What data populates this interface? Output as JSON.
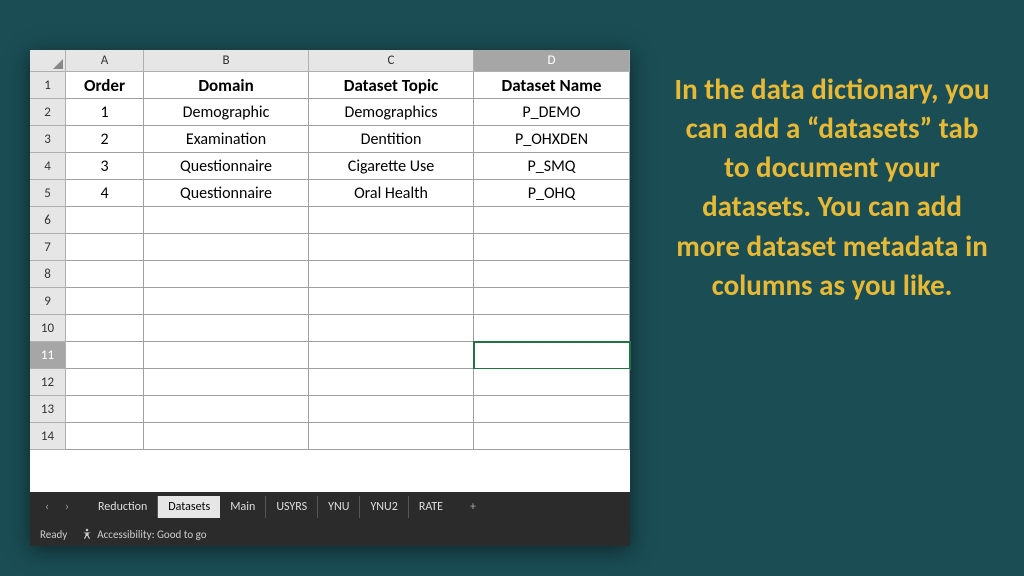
{
  "spreadsheet": {
    "columns": [
      "A",
      "B",
      "C",
      "D"
    ],
    "selected_column_index": 3,
    "selected_row_index": 10,
    "active_cell": "D11",
    "header_row": {
      "order": "Order",
      "domain": "Domain",
      "topic": "Dataset Topic",
      "name": "Dataset Name"
    },
    "data_rows": [
      {
        "order": "1",
        "domain": "Demographic",
        "topic": "Demographics",
        "name": "P_DEMO"
      },
      {
        "order": "2",
        "domain": "Examination",
        "topic": "Dentition",
        "name": "P_OHXDEN"
      },
      {
        "order": "3",
        "domain": "Questionnaire",
        "topic": "Cigarette Use",
        "name": "P_SMQ"
      },
      {
        "order": "4",
        "domain": "Questionnaire",
        "topic": "Oral Health",
        "name": "P_OHQ"
      }
    ],
    "visible_row_count": 14
  },
  "tabs": {
    "items": [
      "Reduction",
      "Datasets",
      "Main",
      "USYRS",
      "YNU",
      "YNU2",
      "RATE"
    ],
    "active_index": 1,
    "nav_prev": "‹",
    "nav_next": "›",
    "add": "+"
  },
  "status": {
    "ready": "Ready",
    "accessibility": "Accessibility: Good to go"
  },
  "callout": {
    "text": "In the data dictionary, you can add a “datasets” tab to document your datasets. You can add more dataset metadata in columns as you like."
  }
}
